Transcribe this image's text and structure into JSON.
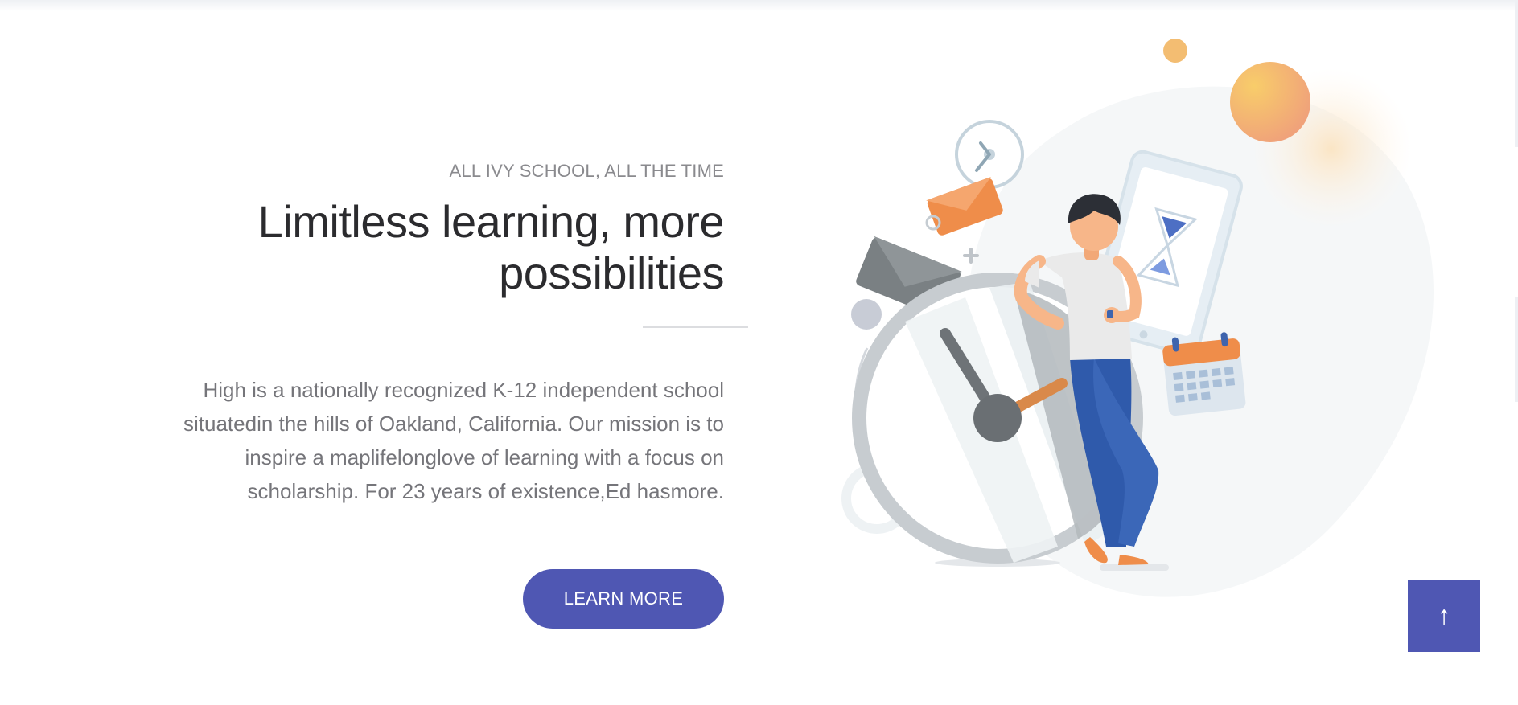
{
  "hero": {
    "eyebrow": "ALL IVY SCHOOL, ALL THE TIME",
    "headline_line1": "Limitless learning, more",
    "headline_line2": "possibilities",
    "description_lines": [
      "High is a nationally recognized K-12 independent school",
      "situatedin the hills of Oakland, California. Our mission is to",
      "inspire a maplifelonglove of learning with a focus on",
      "scholarship. For 23 years of existence,Ed hasmore."
    ],
    "cta_label": "LEARN MORE"
  },
  "scroll_top": {
    "icon": "arrow-up-icon",
    "glyph": "↑"
  },
  "colors": {
    "accent": "#4f57b3",
    "heading": "#2b2b2e",
    "body_text": "#75757a",
    "illustration_orange": "#ef8d4a",
    "illustration_blue": "#2f5aab"
  }
}
